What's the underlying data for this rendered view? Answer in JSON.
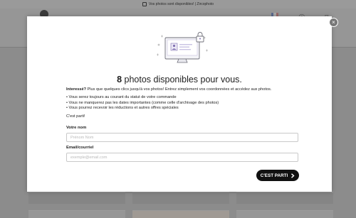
{
  "banner": {
    "text": "Vos photos sont disponibles! | Zircophoto"
  },
  "modal": {
    "title_count": "8",
    "title_rest": " photos disponibles pour vous.",
    "intro_bold": "Interessé?",
    "intro_rest": " Plus que quelques clics jusqu'à vos photos! Entrez simplement vos coordonnées et accédez aux photos.",
    "benefits": [
      "Vous serez toujours au courant du statut de votre commande",
      "Vous ne manquerez pas les dates importantes (comme celle d'archivage des photos)",
      "Vous pourrez recevoir les réductions et autres offres spéciales"
    ],
    "cta_text": "C'est parti!",
    "name_label": "Votre nom",
    "name_placeholder": "Prénom Nom",
    "email_label": "Email/courriel",
    "email_placeholder": "exemple@email.com",
    "submit_label": "C'EST PARTI",
    "close_glyph": "×"
  },
  "colors": {
    "overlay": "#8c8c8c",
    "button": "#111111",
    "illustration_accent": "#7f6fb0",
    "flag": [
      "#3557a8",
      "#ffffff",
      "#d93a3a"
    ]
  },
  "icons": {
    "banner": "photo-icon",
    "illustration": "locked-computer-icon",
    "submit": "chevron-right-icon",
    "close": "close-icon"
  }
}
